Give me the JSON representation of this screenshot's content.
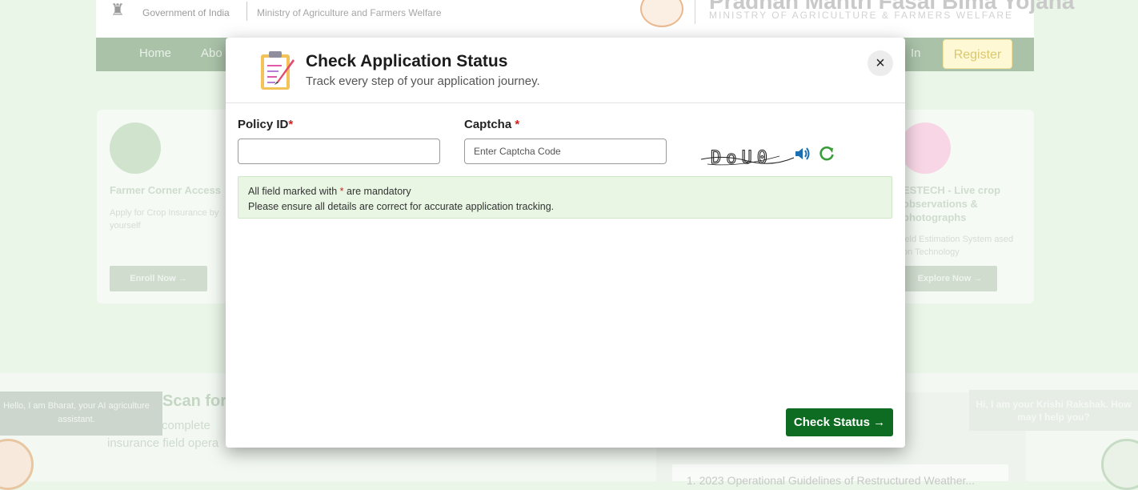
{
  "background": {
    "gov_text": "Government of India",
    "ministry_text": "Ministry of Agriculture and Farmers Welfare",
    "pm_title": "Pradhan Mantri Fasal Bima Yojana",
    "pm_subtitle": "MINISTRY OF AGRICULTURE & FARMERS WELFARE",
    "nav": {
      "home": "Home",
      "about": "Abo",
      "login": "In",
      "register": "Register"
    },
    "card_left": {
      "title": "Farmer Corner Access",
      "desc": "Apply for Crop Insurance by yourself",
      "button": "Enroll Now →"
    },
    "card_right": {
      "title": "ESTECH - Live crop observations & photographs",
      "desc": "ield Estimation System ased on Technology",
      "button": "Explore Now →"
    },
    "scan_title": "Scan for",
    "scan_line1": "complete",
    "scan_line2": "insurance field opera",
    "bot_left": "Hello, I am Bharat, your AI agriculture assistant.",
    "bot_right": "Hi, I am your Krishi Rakshak. How may I help you?",
    "news_text": "1. 2023 Operational Guidelines of Restructured Weather..."
  },
  "modal": {
    "title": "Check Application Status",
    "subtitle": "Track every step of your application journey.",
    "close_label": "×",
    "policy_label": "Policy ID",
    "captcha_label": "Captcha",
    "required_mark": "*",
    "policy_value": "",
    "captcha_placeholder": "Enter Captcha Code",
    "captcha_text": "DoU0",
    "notice_prefix": "All field marked with",
    "notice_suffix": "are mandatory",
    "notice_line2": "Please ensure all details are correct for accurate application tracking.",
    "submit_label": "Check Status →"
  },
  "colors": {
    "accent": "#0e6b22",
    "required": "#d11f1f",
    "notice_bg": "#e8f6e3",
    "speaker": "#1b6fb0",
    "refresh": "#3a9d3a"
  },
  "icons": [
    "clipboard-icon",
    "close-icon",
    "speaker-icon",
    "refresh-icon",
    "arrow-right-icon"
  ]
}
